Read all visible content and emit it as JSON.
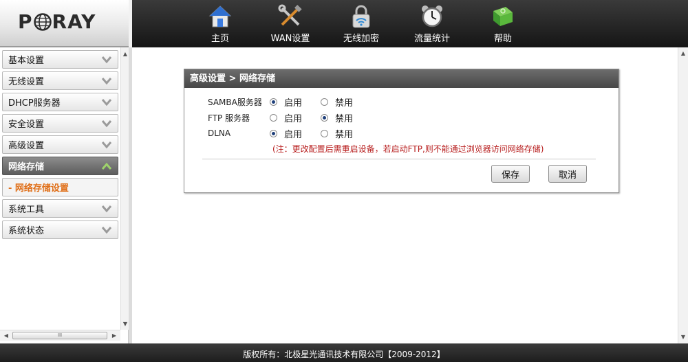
{
  "brand": {
    "logo_text_left": "P",
    "logo_text_right": "RAY"
  },
  "nav": [
    {
      "label": "主页",
      "icon": "home-icon"
    },
    {
      "label": "WAN设置",
      "icon": "tools-icon"
    },
    {
      "label": "无线加密",
      "icon": "wifi-lock-icon"
    },
    {
      "label": "流量统计",
      "icon": "alarm-clock-icon"
    },
    {
      "label": "帮助",
      "icon": "help-book-icon"
    }
  ],
  "sidebar": {
    "items": [
      {
        "label": "基本设置"
      },
      {
        "label": "无线设置"
      },
      {
        "label": "DHCP服务器"
      },
      {
        "label": "安全设置"
      },
      {
        "label": "高级设置"
      },
      {
        "label": "网络存储"
      },
      {
        "label": "- 网络存储设置"
      },
      {
        "label": "系统工具"
      },
      {
        "label": "系统状态"
      }
    ],
    "hscroll_thumb": "III"
  },
  "panel": {
    "title": "高级设置 > 网络存储",
    "rows": [
      {
        "label": "SAMBA服务器",
        "enable": "启用",
        "disable": "禁用",
        "value": "enable"
      },
      {
        "label": "FTP 服务器",
        "enable": "启用",
        "disable": "禁用",
        "value": "disable"
      },
      {
        "label": "DLNA",
        "enable": "启用",
        "disable": "禁用",
        "value": "enable"
      }
    ],
    "note": "(注：更改配置后需重启设备，若启动FTP,则不能通过浏览器访问网络存储)",
    "save_label": "保存",
    "cancel_label": "取消"
  },
  "footer": {
    "copyright": "版权所有：北极星光通讯技术有限公司【2009-2012】"
  },
  "colors": {
    "accent_orange": "#e0701a",
    "note_red": "#b71c1c",
    "header_dark": "#151515"
  }
}
